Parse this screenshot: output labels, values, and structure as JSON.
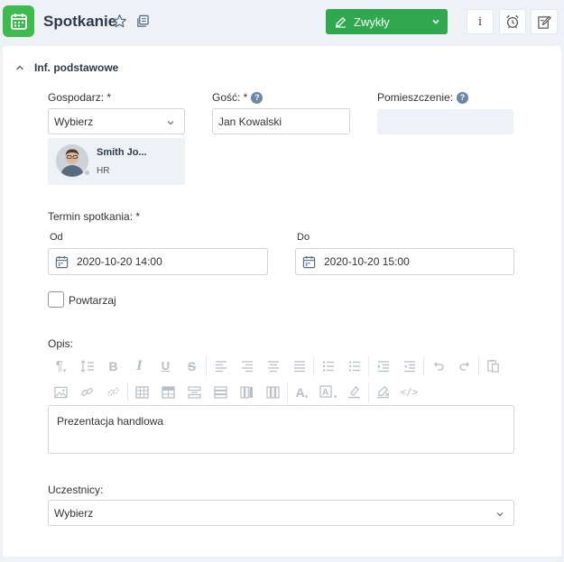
{
  "header": {
    "title": "Spotkanie",
    "status_label": "Zwykły",
    "status_color": "#2fa84f",
    "app_icon_color": "#3ebb4f",
    "icons": [
      "calendar-icon",
      "star-icon",
      "copy-icon",
      "pencil-icon",
      "chevron-down-icon",
      "info-icon",
      "alarm-clock-icon",
      "edit-note-icon"
    ]
  },
  "section": {
    "title": "Inf. podstawowe"
  },
  "form": {
    "host_label": "Gospodarz: *",
    "host_select_value": "Wybierz",
    "host_card": {
      "name": "Smith Jo...",
      "dept": "HR"
    },
    "guest_label": "Gość: *",
    "guest_value": "Jan Kowalski",
    "room_label": "Pomieszczenie:",
    "room_value": "",
    "term_label": "Termin spotkania: *",
    "from_label": "Od",
    "from_value": "2020-10-20 14:00",
    "to_label": "Do",
    "to_value": "2020-10-20 15:00",
    "repeat_label": "Powtarzaj",
    "repeat_checked": false,
    "description_label": "Opis:",
    "description_value": "Prezentacja handlowa",
    "participants_label": "Uczestnicy:",
    "participants_value": "Wybierz"
  },
  "toolbar_rows": [
    [
      "paragraph-icon",
      "line-height-icon",
      "bold-icon",
      "italic-icon",
      "underline-icon",
      "strikethrough-icon",
      "align-left-icon",
      "align-center-icon",
      "align-justify-icon",
      "align-full-icon",
      "ordered-list-icon",
      "unordered-list-icon",
      "indent-icon",
      "outdent-icon",
      "undo-icon",
      "redo-icon",
      "paste-icon"
    ],
    [
      "image-icon",
      "link-icon",
      "unlink-icon",
      "table-icon",
      "table-props-icon",
      "insert-row-icon",
      "delete-row-icon",
      "insert-column-icon",
      "delete-column-icon",
      "text-color-icon",
      "background-color-icon",
      "highlight-icon",
      "clear-format-icon",
      "code-view-icon"
    ]
  ]
}
